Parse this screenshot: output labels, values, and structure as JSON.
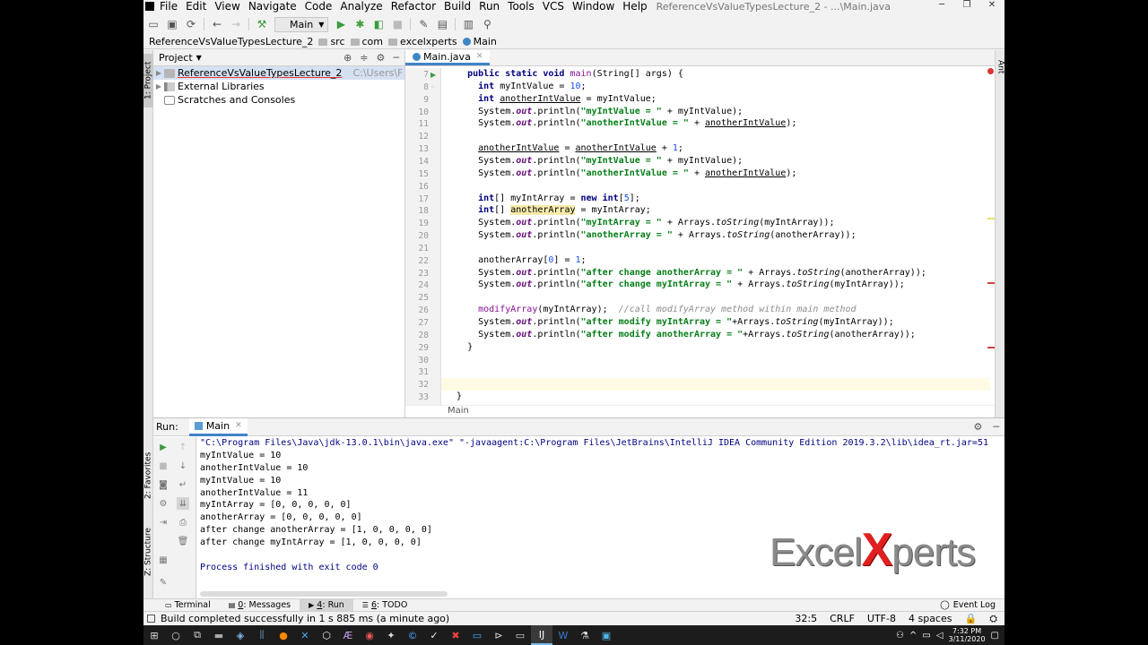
{
  "window": {
    "title": "ReferenceVsValueTypesLecture_2 - ...\\Main.java",
    "menu": [
      "File",
      "Edit",
      "View",
      "Navigate",
      "Code",
      "Analyze",
      "Refactor",
      "Build",
      "Run",
      "Tools",
      "VCS",
      "Window",
      "Help"
    ]
  },
  "toolbar": {
    "run_config": "Main"
  },
  "breadcrumb": [
    "ReferenceVsValueTypesLecture_2",
    "src",
    "com",
    "excelxperts",
    "Main"
  ],
  "sidebar": {
    "stripe_project": "1: Project",
    "stripe_favorites": "2: Favorites",
    "stripe_structure": "Z: Structure",
    "stripe_ant": "Ant"
  },
  "project": {
    "header": "Project",
    "items": [
      {
        "label": "ReferenceVsValueTypesLecture_2",
        "path": "C:\\Users\\F"
      },
      {
        "label": "External Libraries"
      },
      {
        "label": "Scratches and Consoles"
      }
    ]
  },
  "editor": {
    "tab": "Main.java",
    "footer": "Main",
    "line_numbers": [
      "7",
      "8",
      "9",
      "10",
      "11",
      "12",
      "13",
      "14",
      "15",
      "16",
      "17",
      "18",
      "19",
      "20",
      "21",
      "22",
      "23",
      "24",
      "25",
      "26",
      "27",
      "28",
      "29",
      "30",
      "31",
      "32",
      "33"
    ],
    "lines": [
      [
        "",
        "public static void ",
        "main",
        "(String[] args) {"
      ],
      [
        "int ",
        "myIntValue = ",
        "10",
        ";"
      ],
      [
        "int ",
        "anotherIntValue",
        " = myIntValue;"
      ],
      [
        "System.",
        "out",
        ".println(",
        "\"myIntValue = \"",
        " + myIntValue);"
      ],
      [
        "System.",
        "out",
        ".println(",
        "\"anotherIntValue = \"",
        " + ",
        "anotherIntValue",
        ");"
      ],
      [
        "anotherIntValue",
        " = ",
        "anotherIntValue",
        " + ",
        "1",
        ";"
      ],
      [
        "System.",
        "out",
        ".println(",
        "\"myIntValue = \"",
        " + myIntValue);"
      ],
      [
        "System.",
        "out",
        ".println(",
        "\"anotherIntValue = \"",
        " + ",
        "anotherIntValue",
        ");"
      ],
      [
        "int",
        "[] myIntArray = ",
        "new int",
        "[",
        "5",
        "];"
      ],
      [
        "int",
        "[] ",
        "anotherArray",
        " = myIntArray;"
      ],
      [
        "System.",
        "out",
        ".println(",
        "\"myIntArray = \"",
        " + Arrays.",
        "toString",
        "(myIntArray));"
      ],
      [
        "System.",
        "out",
        ".println(",
        "\"anotherArray = \"",
        " + Arrays.",
        "toString",
        "(anotherArray));"
      ],
      [
        "anotherArray[",
        "0",
        "] = ",
        "1",
        ";"
      ],
      [
        "System.",
        "out",
        ".println(",
        "\"after change anotherArray = \"",
        " + Arrays.",
        "toString",
        "(anotherArray));"
      ],
      [
        "System.",
        "out",
        ".println(",
        "\"after change myIntArray = \"",
        " + Arrays.",
        "toString",
        "(myIntArray));"
      ],
      [
        "modifyArray",
        "(myIntArray);  ",
        "//call modifyArray method within main method"
      ],
      [
        "System.",
        "out",
        ".println(",
        "\"after modify myIntArray = \"",
        "+Arrays.",
        "toString",
        "(myIntArray));"
      ],
      [
        "System.",
        "out",
        ".println(",
        "\"after modify anotherArray = \"",
        "+Arrays.",
        "toString",
        "(anotherArray));"
      ],
      [
        "}"
      ],
      [
        "}"
      ]
    ]
  },
  "run": {
    "label": "Run:",
    "tab": "Main",
    "console": [
      "\"C:\\Program Files\\Java\\jdk-13.0.1\\bin\\java.exe\" \"-javaagent:C:\\Program Files\\JetBrains\\IntelliJ IDEA Community Edition 2019.3.2\\lib\\idea_rt.jar=51",
      "myIntValue = 10",
      "anotherIntValue = 10",
      "myIntValue = 10",
      "anotherIntValue = 11",
      "myIntArray = [0, 0, 0, 0, 0]",
      "anotherArray = [0, 0, 0, 0, 0]",
      "after change anotherArray = [1, 0, 0, 0, 0]",
      "after change myIntArray = [1, 0, 0, 0, 0]",
      "",
      "Process finished with exit code 0"
    ]
  },
  "watermark": {
    "prefix": "Excel",
    "x": "X",
    "suffix": "perts"
  },
  "bottom_tabs": [
    {
      "num": "",
      "label": "Terminal"
    },
    {
      "num": "0",
      "label": ": Messages"
    },
    {
      "num": "4",
      "label": ": Run"
    },
    {
      "num": "6",
      "label": ": TODO"
    }
  ],
  "event_log": "Event Log",
  "status": {
    "message": "Build completed successfully in 1 s 885 ms (a minute ago)",
    "position": "32:5",
    "line_sep": "CRLF",
    "encoding": "UTF-8",
    "indent": "4 spaces"
  },
  "taskbar": {
    "time": "7:32 PM",
    "date": "3/11/2020"
  },
  "colors": {
    "accent": "#4083c9",
    "keyword": "#000080",
    "string": "#067d17",
    "field": "#660e7a",
    "number": "#1750eb",
    "watermark_x": "#e02020"
  }
}
